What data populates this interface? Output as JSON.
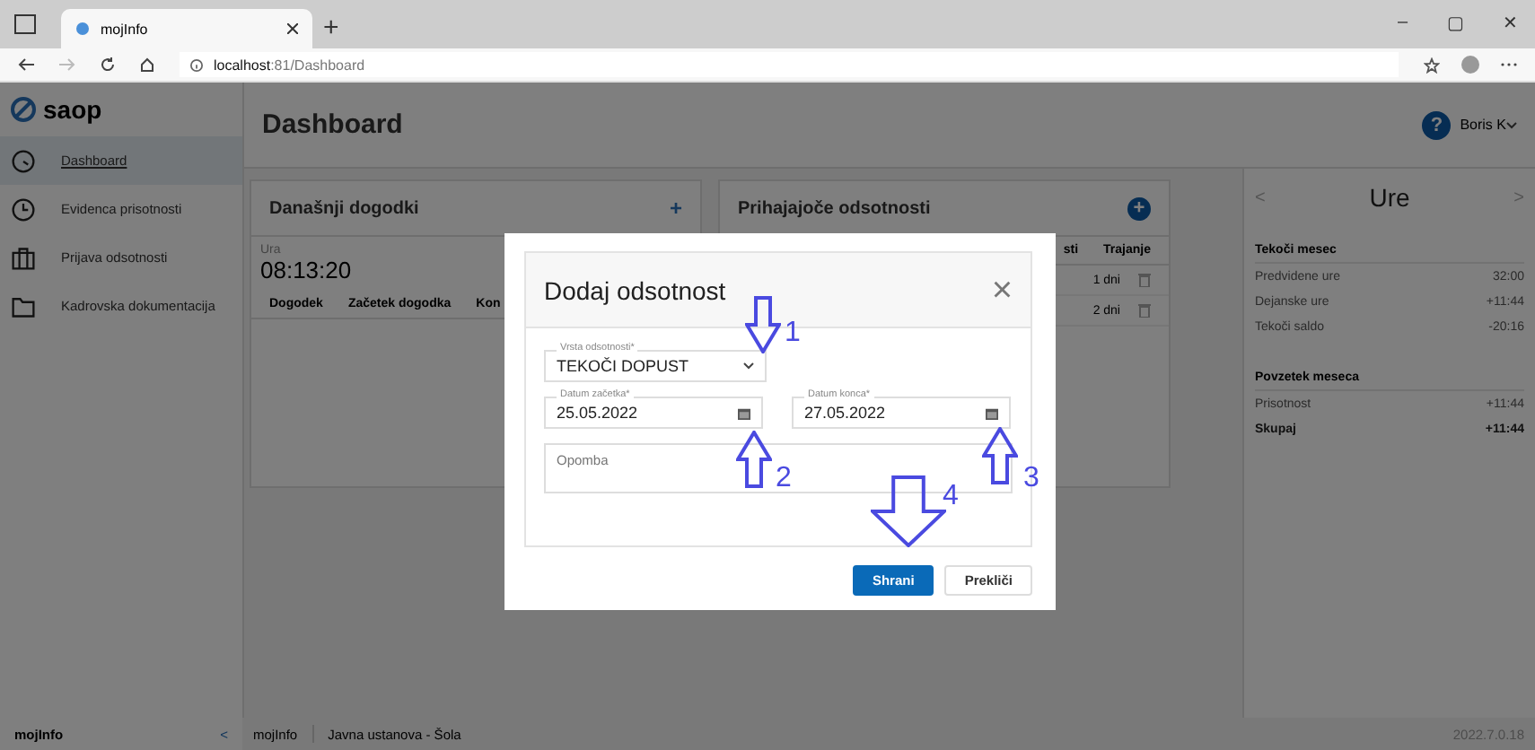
{
  "browser": {
    "tab_title": "mojInfo",
    "new_tab": "+",
    "address_host": "localhost",
    "address_path": ":81/Dashboard",
    "controls": [
      "–",
      "▢",
      "✕"
    ]
  },
  "sidebar": {
    "logo": "saop",
    "items": [
      {
        "label": "Dashboard",
        "selected": true
      },
      {
        "label": "Evidenca prisotnosti",
        "selected": false
      },
      {
        "label": "Prijava odsotnosti",
        "selected": false
      },
      {
        "label": "Kadrovska dokumentacija",
        "selected": false
      }
    ],
    "footer": "mojInfo",
    "collapse": "<"
  },
  "header": {
    "title": "Dashboard",
    "help": "?",
    "user": "Boris K"
  },
  "todays_events": {
    "title": "Današnji dogodki",
    "add": "+",
    "clock_label": "Ura",
    "clock": "08:13:20",
    "columns": [
      "Dogodek",
      "Začetek dogodka",
      "Kon"
    ]
  },
  "upcoming_absences": {
    "title": "Prihajajoče odsotnosti",
    "add": "+",
    "columns": [
      "sti",
      "Trajanje"
    ],
    "rows": [
      {
        "duration": "1 dni"
      },
      {
        "duration": "2 dni"
      }
    ]
  },
  "hours": {
    "title": "Ure",
    "prev": "<",
    "next": ">",
    "sections": [
      {
        "title": "Tekoči mesec",
        "rows": [
          {
            "label": "Predvidene ure",
            "value": "32:00",
            "bold": false
          },
          {
            "label": "Dejanske ure",
            "value": "+11:44",
            "bold": false
          },
          {
            "label": "Tekoči saldo",
            "value": "-20:16",
            "bold": false
          }
        ]
      },
      {
        "title": "Povzetek meseca",
        "rows": [
          {
            "label": "Prisotnost",
            "value": "+11:44",
            "bold": false
          },
          {
            "label": "Skupaj",
            "value": "+11:44",
            "bold": true
          }
        ]
      }
    ]
  },
  "status_bar": {
    "app": "mojInfo",
    "organization": "Javna ustanova - Šola",
    "version": "2022.7.0.18"
  },
  "dialog": {
    "title": "Dodaj odsotnost",
    "close": "×",
    "type_field": {
      "label": "Vrsta odsotnosti*",
      "value": "TEKOČI DOPUST"
    },
    "start_field": {
      "label": "Datum začetka*",
      "value": "25.05.2022"
    },
    "end_field": {
      "label": "Datum konca*",
      "value": "27.05.2022"
    },
    "note_field": {
      "placeholder": "Opomba"
    },
    "buttons": [
      {
        "label": "Shrani",
        "kind": "primary"
      },
      {
        "label": "Prekliči",
        "kind": "secondary"
      }
    ],
    "annotations": [
      {
        "label": "1",
        "kind": "down"
      },
      {
        "label": "2",
        "kind": "up"
      },
      {
        "label": "3",
        "kind": "up"
      },
      {
        "label": "4",
        "kind": "down"
      }
    ]
  }
}
